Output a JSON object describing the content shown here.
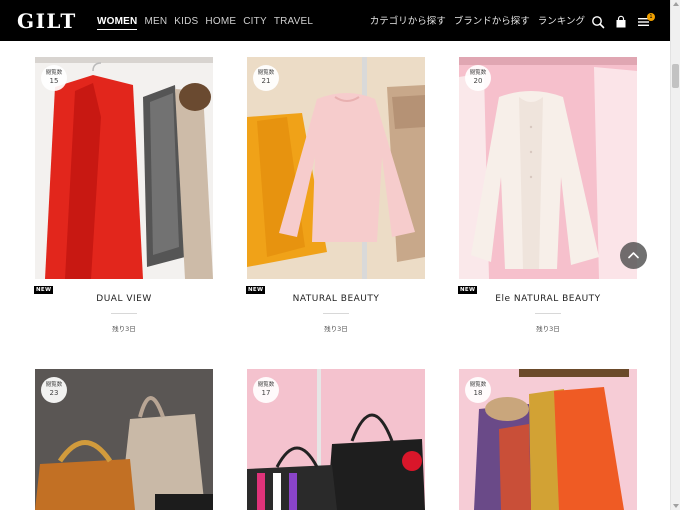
{
  "header": {
    "logo": "GILT",
    "nav_main": [
      "WOMEN",
      "MEN",
      "KIDS",
      "HOME",
      "CITY",
      "TRAVEL"
    ],
    "active_nav": "WOMEN",
    "nav_right": [
      "カテゴリから探す",
      "ブランドから探す",
      "ランキング"
    ],
    "cart_count": "1",
    "icons": [
      "search-icon",
      "shopping-bag-icon",
      "menu-icon"
    ]
  },
  "products": [
    {
      "badge_label": "閲覧数",
      "views": "15",
      "tag": "NEW",
      "name": "DUAL VIEW",
      "remaining": "残り3日"
    },
    {
      "badge_label": "閲覧数",
      "views": "21",
      "tag": "NEW",
      "name": "NATURAL BEAUTY",
      "remaining": "残り3日"
    },
    {
      "badge_label": "閲覧数",
      "views": "20",
      "tag": "NEW",
      "name": "Ele NATURAL BEAUTY",
      "remaining": "残り3日"
    },
    {
      "badge_label": "閲覧数",
      "views": "23"
    },
    {
      "badge_label": "閲覧数",
      "views": "17"
    },
    {
      "badge_label": "閲覧数",
      "views": "18"
    }
  ],
  "colors": {
    "header_bg": "#000000",
    "badge_accent": "#f0a000",
    "new_tag_bg": "#000000",
    "scroll_top_button": "#555555"
  }
}
